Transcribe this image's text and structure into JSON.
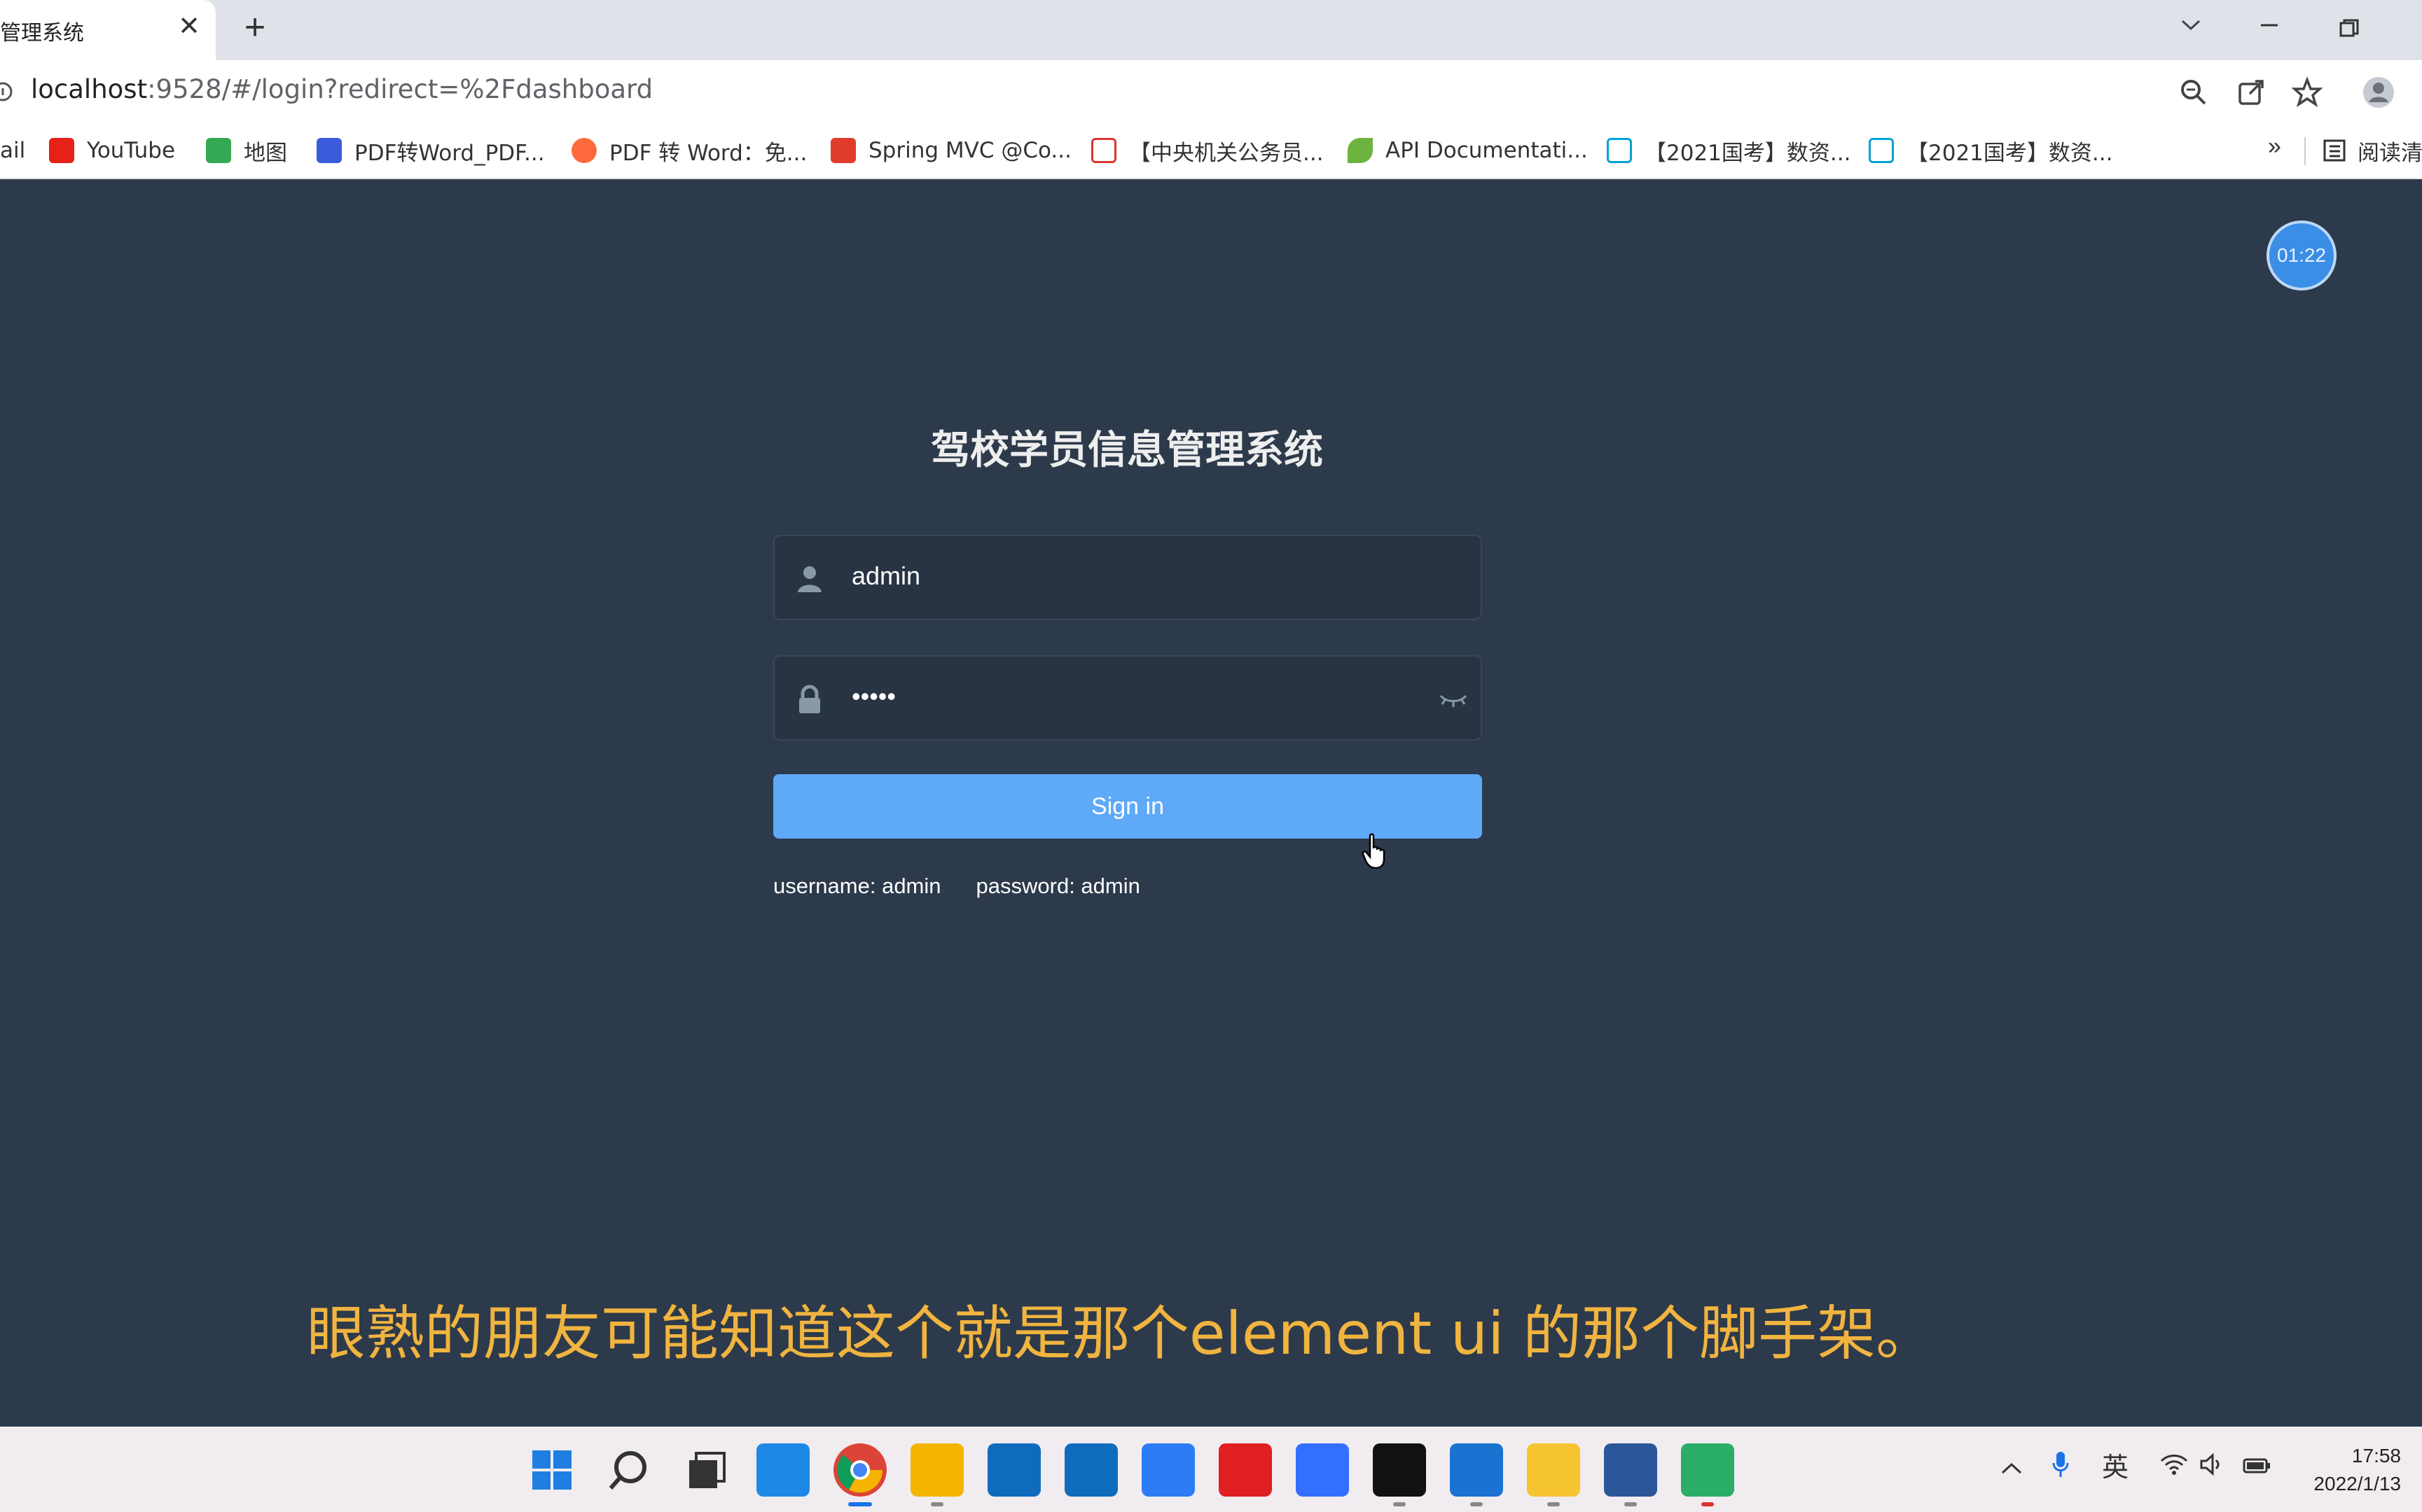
{
  "browser": {
    "tab_title": "管理系统",
    "tab_close": "✕",
    "new_tab": "+",
    "url_host": "localhost",
    "url_path": ":9528/#/login?redirect=%2Fdashboard",
    "bookmarks": [
      {
        "label": "ail",
        "color": ""
      },
      {
        "label": "YouTube",
        "color": "#e62117"
      },
      {
        "label": "地图",
        "color": "#34a853"
      },
      {
        "label": "PDF转Word_PDF...",
        "color": "#3b5bdb"
      },
      {
        "label": "PDF 转 Word：免...",
        "color": "#ff6a3d"
      },
      {
        "label": "Spring MVC @Co...",
        "color": "#e03c2b"
      },
      {
        "label": "【中央机关公务员...",
        "color": "#d33"
      },
      {
        "label": "API Documentati...",
        "color": "#6db33f"
      },
      {
        "label": "【2021国考】数资...",
        "color": "#00a1d6"
      },
      {
        "label": "【2021国考】数资...",
        "color": "#00a1d6"
      }
    ],
    "bookmarks_more": "»",
    "reading_list": "阅读清"
  },
  "login": {
    "timer": "01:22",
    "title": "驾校学员信息管理系统",
    "username_value": "admin",
    "password_value": "•••••",
    "signin_label": "Sign in",
    "tip_username": "username: admin",
    "tip_password": "password: admin"
  },
  "subtitle": "眼熟的朋友可能知道这个就是那个element ui 的那个脚手架。",
  "taskbar": {
    "ime": "英",
    "time": "17:58",
    "date": "2022/1/13",
    "apps": [
      {
        "name": "start",
        "color": "#1f7fe0"
      },
      {
        "name": "search",
        "color": "#333333"
      },
      {
        "name": "task-view",
        "color": "#333333"
      },
      {
        "name": "widgets",
        "color": "#1e88e5"
      },
      {
        "name": "chrome",
        "color": "#db4437"
      },
      {
        "name": "file-explorer",
        "color": "#f4b400"
      },
      {
        "name": "microsoft-store",
        "color": "#0f6cbd"
      },
      {
        "name": "mail",
        "color": "#0f6cbd"
      },
      {
        "name": "lark",
        "color": "#2c7cf6"
      },
      {
        "name": "youdao",
        "color": "#e02020"
      },
      {
        "name": "feishu",
        "color": "#3370ff"
      },
      {
        "name": "intellij",
        "color": "#111111"
      },
      {
        "name": "vscode",
        "color": "#1a73d0"
      },
      {
        "name": "cheese-app",
        "color": "#f5c430"
      },
      {
        "name": "word",
        "color": "#2b579a"
      },
      {
        "name": "wechat",
        "color": "#2aae67"
      }
    ]
  },
  "colors": {
    "page_bg": "#2d3a4b",
    "input_bg": "#283443",
    "button": "#5ea9f8",
    "subtitle": "#f0b43f"
  }
}
